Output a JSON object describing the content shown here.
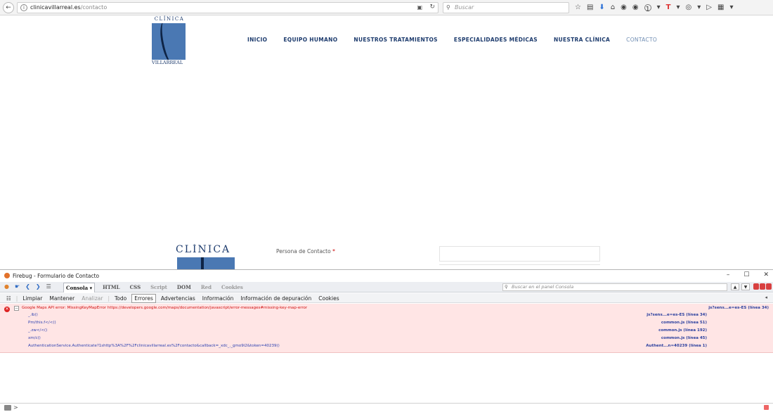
{
  "browser": {
    "url_host": "clinicavillarreal.es",
    "url_path": "/contacto",
    "search_placeholder": "Buscar"
  },
  "site": {
    "logo_top": "CLÍNICA",
    "logo_bottom": "VILLARREAL",
    "nav": [
      "INICIO",
      "EQUIPO HUMANO",
      "NUESTROS TRATAMIENTOS",
      "ESPECIALIDADES MÉDICAS",
      "NUESTRA CLÍNICA",
      "CONTACTO"
    ],
    "active_nav": "CONTACTO",
    "logo2": "CLÍNICA",
    "contact_label": "Persona de Contacto",
    "required_marker": "*"
  },
  "firebug": {
    "title": "Firebug - Formulario de Contacto",
    "tabs": [
      "Consola ▾",
      "HTML",
      "CSS",
      "Script",
      "DOM",
      "Red",
      "Cookies"
    ],
    "console_search_placeholder": "Buscar en el panel Consola",
    "filters": [
      "Limpiar",
      "Mantener",
      "Analizar",
      "Todo",
      "Errores",
      "Advertencias",
      "Información",
      "Información de depuración",
      "Cookies"
    ],
    "active_filter": "Errores",
    "error": {
      "message": "Google Maps API error: MissingKeyMapError https://developers.google.com/maps/documentation/javascript/error-messages#missing-key-map-error",
      "source": "js?sens...e=es-ES (línea 34)",
      "trace": [
        {
          "fn": "_.ib()",
          "src": "js?sens...e=es-ES (línea 34)"
        },
        {
          "fn": "Pm/this.f</<()",
          "src": "common.js (línea 51)"
        },
        {
          "fn": "_.zw</<()",
          "src": "common.js (línea 192)"
        },
        {
          "fn": "xm/c()",
          "src": "common.js (línea 45)"
        },
        {
          "fn": "AuthenticationService.Authenticate?1shttp%3A%2F%2Fclinicavillarreal.es%2Fcontacto&callback=_xdc_._gmo9i2&token=40239()",
          "src": "Authent...n=40239 (línea 1)"
        }
      ]
    },
    "cmd_prompt": ">"
  },
  "colors": {
    "brand_navy": "#1e3c6e",
    "brand_blue": "#4a78b3",
    "error_bg": "#ffe5e5",
    "error_text": "#d01010"
  }
}
